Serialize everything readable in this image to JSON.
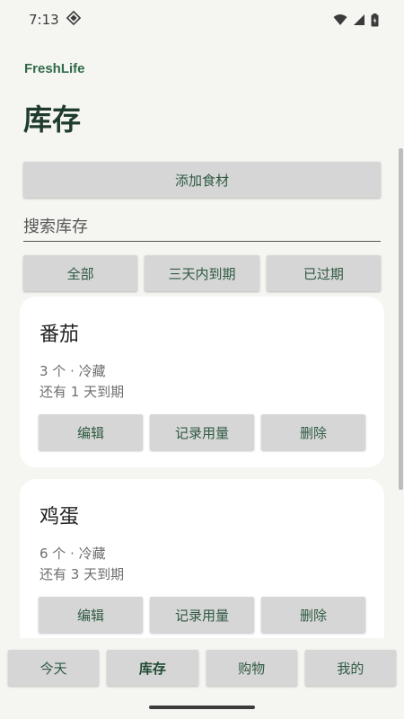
{
  "status_bar": {
    "time": "7:13",
    "icons": [
      "data-saver-icon",
      "wifi-icon",
      "signal-icon",
      "battery-icon"
    ]
  },
  "header": {
    "brand": "FreshLife",
    "title": "库存"
  },
  "actions": {
    "add_label": "添加食材"
  },
  "search": {
    "placeholder": "搜索库存",
    "value": ""
  },
  "filters": [
    {
      "label": "全部"
    },
    {
      "label": "三天内到期"
    },
    {
      "label": "已过期"
    }
  ],
  "items": [
    {
      "name": "番茄",
      "quantity_location": "3 个 · 冷藏",
      "expiry": "还有 1 天到期",
      "buttons": {
        "edit": "编辑",
        "log_usage": "记录用量",
        "delete": "删除"
      }
    },
    {
      "name": "鸡蛋",
      "quantity_location": "6 个 · 冷藏",
      "expiry": "还有 3 天到期",
      "buttons": {
        "edit": "编辑",
        "log_usage": "记录用量",
        "delete": "删除"
      }
    }
  ],
  "bottom_nav": [
    {
      "label": "今天",
      "active": false
    },
    {
      "label": "库存",
      "active": true
    },
    {
      "label": "购物",
      "active": false
    },
    {
      "label": "我的",
      "active": false
    }
  ],
  "colors": {
    "background": "#f5f5f1",
    "brand": "#2f6b48",
    "button_bg": "#d6d6d6",
    "button_text": "#2f5a42",
    "card_bg": "#ffffff"
  }
}
